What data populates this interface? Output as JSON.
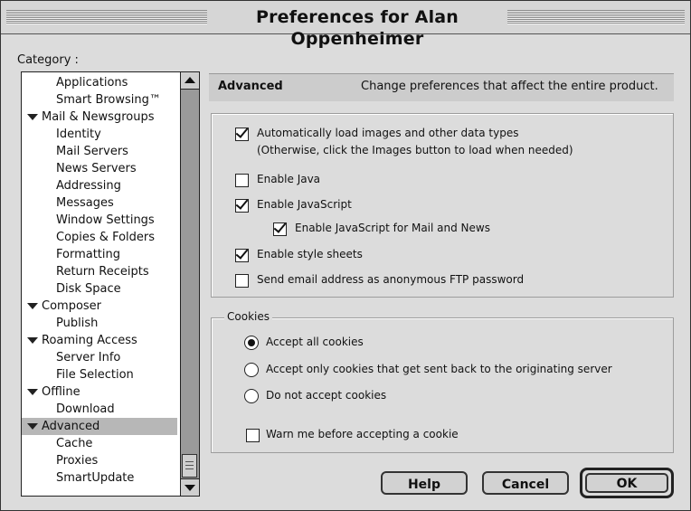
{
  "window": {
    "title": "Preferences for Alan Oppenheimer"
  },
  "sidebar": {
    "label": "Category :",
    "items": [
      {
        "label": "Applications",
        "level": 1,
        "expanded": false,
        "selected": false
      },
      {
        "label": "Smart Browsing™",
        "level": 1,
        "expanded": false,
        "selected": false
      },
      {
        "label": "Mail & Newsgroups",
        "level": 0,
        "expanded": true,
        "selected": false
      },
      {
        "label": "Identity",
        "level": 1,
        "expanded": false,
        "selected": false
      },
      {
        "label": "Mail Servers",
        "level": 1,
        "expanded": false,
        "selected": false
      },
      {
        "label": "News Servers",
        "level": 1,
        "expanded": false,
        "selected": false
      },
      {
        "label": "Addressing",
        "level": 1,
        "expanded": false,
        "selected": false
      },
      {
        "label": "Messages",
        "level": 1,
        "expanded": false,
        "selected": false
      },
      {
        "label": "Window Settings",
        "level": 1,
        "expanded": false,
        "selected": false
      },
      {
        "label": "Copies & Folders",
        "level": 1,
        "expanded": false,
        "selected": false
      },
      {
        "label": "Formatting",
        "level": 1,
        "expanded": false,
        "selected": false
      },
      {
        "label": "Return Receipts",
        "level": 1,
        "expanded": false,
        "selected": false
      },
      {
        "label": "Disk Space",
        "level": 1,
        "expanded": false,
        "selected": false
      },
      {
        "label": "Composer",
        "level": 0,
        "expanded": true,
        "selected": false
      },
      {
        "label": "Publish",
        "level": 1,
        "expanded": false,
        "selected": false
      },
      {
        "label": "Roaming Access",
        "level": 0,
        "expanded": true,
        "selected": false
      },
      {
        "label": "Server Info",
        "level": 1,
        "expanded": false,
        "selected": false
      },
      {
        "label": "File Selection",
        "level": 1,
        "expanded": false,
        "selected": false
      },
      {
        "label": "Offline",
        "level": 0,
        "expanded": true,
        "selected": false
      },
      {
        "label": "Download",
        "level": 1,
        "expanded": false,
        "selected": false
      },
      {
        "label": "Advanced",
        "level": 0,
        "expanded": true,
        "selected": true
      },
      {
        "label": "Cache",
        "level": 1,
        "expanded": false,
        "selected": false
      },
      {
        "label": "Proxies",
        "level": 1,
        "expanded": false,
        "selected": false
      },
      {
        "label": "SmartUpdate",
        "level": 1,
        "expanded": false,
        "selected": false
      }
    ]
  },
  "panel": {
    "title": "Advanced",
    "description": "Change preferences that affect the entire product.",
    "options": [
      {
        "label": "Automatically load images and other data types",
        "checked": true
      },
      {
        "label": "(Otherwise, click the Images button to load when needed)"
      },
      {
        "label": "Enable Java",
        "checked": false
      },
      {
        "label": "Enable JavaScript",
        "checked": true
      },
      {
        "label": "Enable JavaScript for Mail and News",
        "checked": true
      },
      {
        "label": "Enable style sheets",
        "checked": true
      },
      {
        "label": "Send email address as anonymous FTP password",
        "checked": false
      }
    ],
    "cookies": {
      "title": "Cookies",
      "options": [
        {
          "label": "Accept all cookies",
          "selected": true
        },
        {
          "label": "Accept only cookies that get sent back to the originating server",
          "selected": false
        },
        {
          "label": "Do not accept cookies",
          "selected": false
        }
      ],
      "warn": {
        "label": "Warn me before accepting a cookie",
        "checked": false
      }
    }
  },
  "buttons": {
    "help": "Help",
    "cancel": "Cancel",
    "ok": "OK"
  },
  "colors": {
    "window_bg": "#dcdcdc",
    "selection": "#b7b7b7",
    "scrollbar": "#9a9a9a"
  }
}
